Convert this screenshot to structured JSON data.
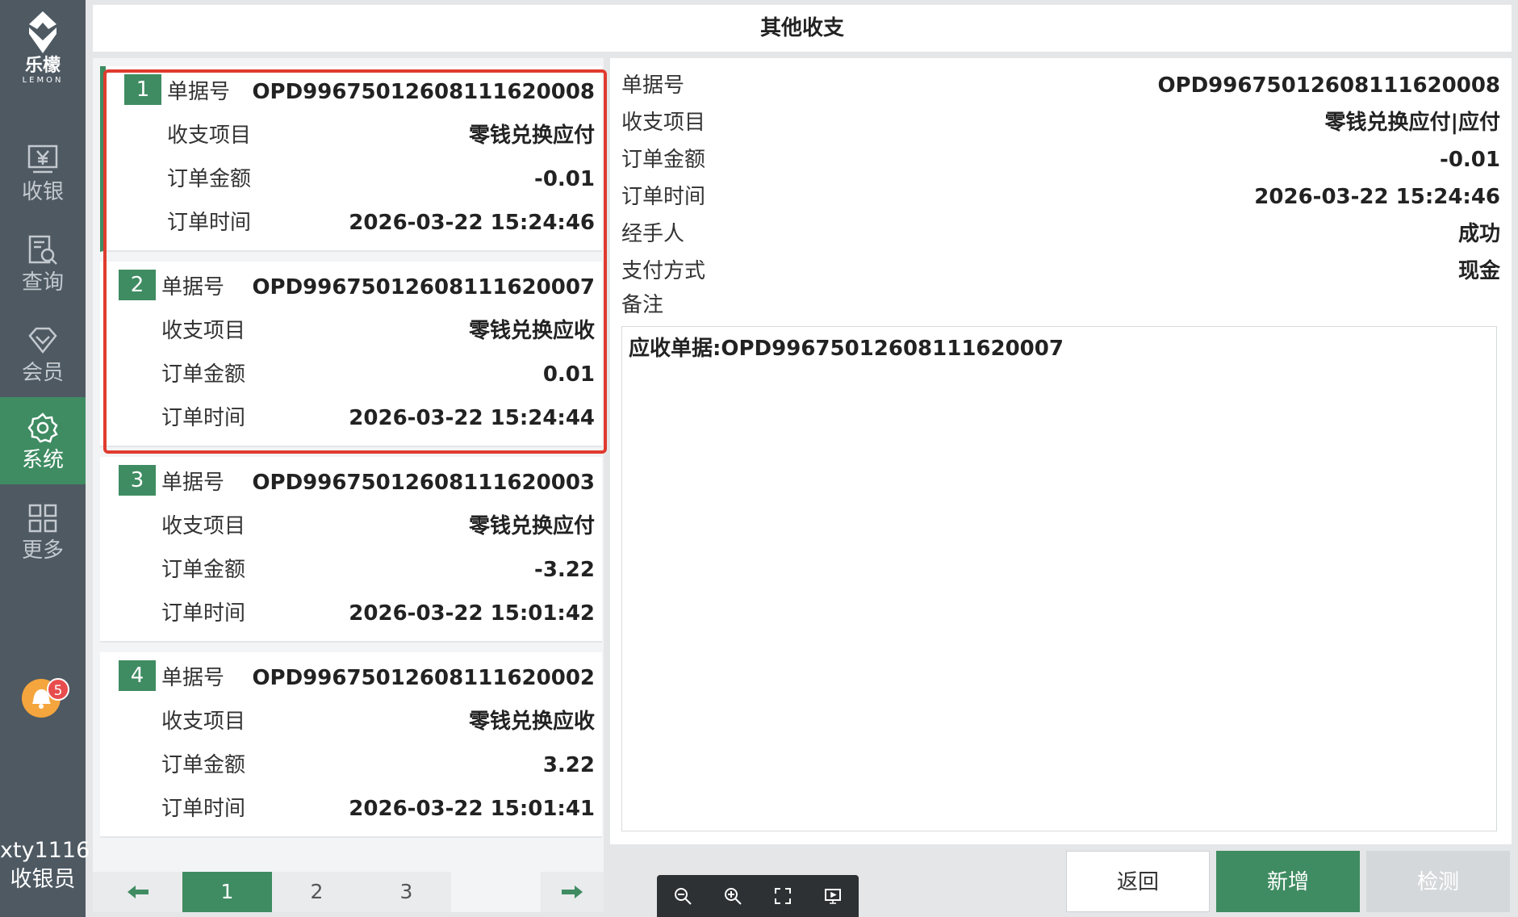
{
  "header": {
    "title": "其他收支"
  },
  "sidebar": {
    "brand": "乐檬",
    "brand_en": "LEMON",
    "items": [
      {
        "label": "收银",
        "icon": "cashier-icon"
      },
      {
        "label": "查询",
        "icon": "query-icon"
      },
      {
        "label": "会员",
        "icon": "member-icon"
      },
      {
        "label": "系统",
        "icon": "gear-icon",
        "active": true
      },
      {
        "label": "更多",
        "icon": "grid-icon"
      }
    ],
    "notifications": "5",
    "user_name": "xty1116",
    "user_role": "收银员"
  },
  "list": {
    "field_labels": {
      "doc_no": "单据号",
      "item": "收支项目",
      "amount": "订单金额",
      "time": "订单时间"
    },
    "cards": [
      {
        "num": "1",
        "doc_no": "OPD996750126081116200​08",
        "item": "零钱兑换应付",
        "amount": "-0.01",
        "time": "2026-03-22 15:24:46"
      },
      {
        "num": "2",
        "doc_no": "OPD99675012608111620007",
        "item": "零钱兑换应收",
        "amount": "0.01",
        "time": "2026-03-22 15:24:44"
      },
      {
        "num": "3",
        "doc_no": "OPD99675012608111620003",
        "item": "零钱兑换应付",
        "amount": "-3.22",
        "time": "2026-03-22 15:01:42"
      },
      {
        "num": "4",
        "doc_no": "OPD99675012608111620002",
        "item": "零钱兑换应收",
        "amount": "3.22",
        "time": "2026-03-22 15:01:41"
      }
    ]
  },
  "pager": {
    "pages": [
      "1",
      "2",
      "3"
    ],
    "current": "1"
  },
  "detail": {
    "doc_no_label": "单据号",
    "doc_no": "OPD99675012608111620008",
    "item_label": "收支项目",
    "item": "零钱兑换应付|应付",
    "amount_label": "订单金额",
    "amount": "-0.01",
    "time_label": "订单时间",
    "time": "2026-03-22 15:24:46",
    "handler_label": "经手人",
    "handler": "成功",
    "pay_label": "支付方式",
    "pay": "现金",
    "remark_label": "备注",
    "remark": "应收单据:OPD99675012608111620007"
  },
  "buttons": {
    "back": "返回",
    "add": "新增",
    "detect": "检测"
  },
  "colors": {
    "accent": "#3f8c62",
    "sidebar": "#4e5962",
    "highlight": "#e03b2f"
  }
}
